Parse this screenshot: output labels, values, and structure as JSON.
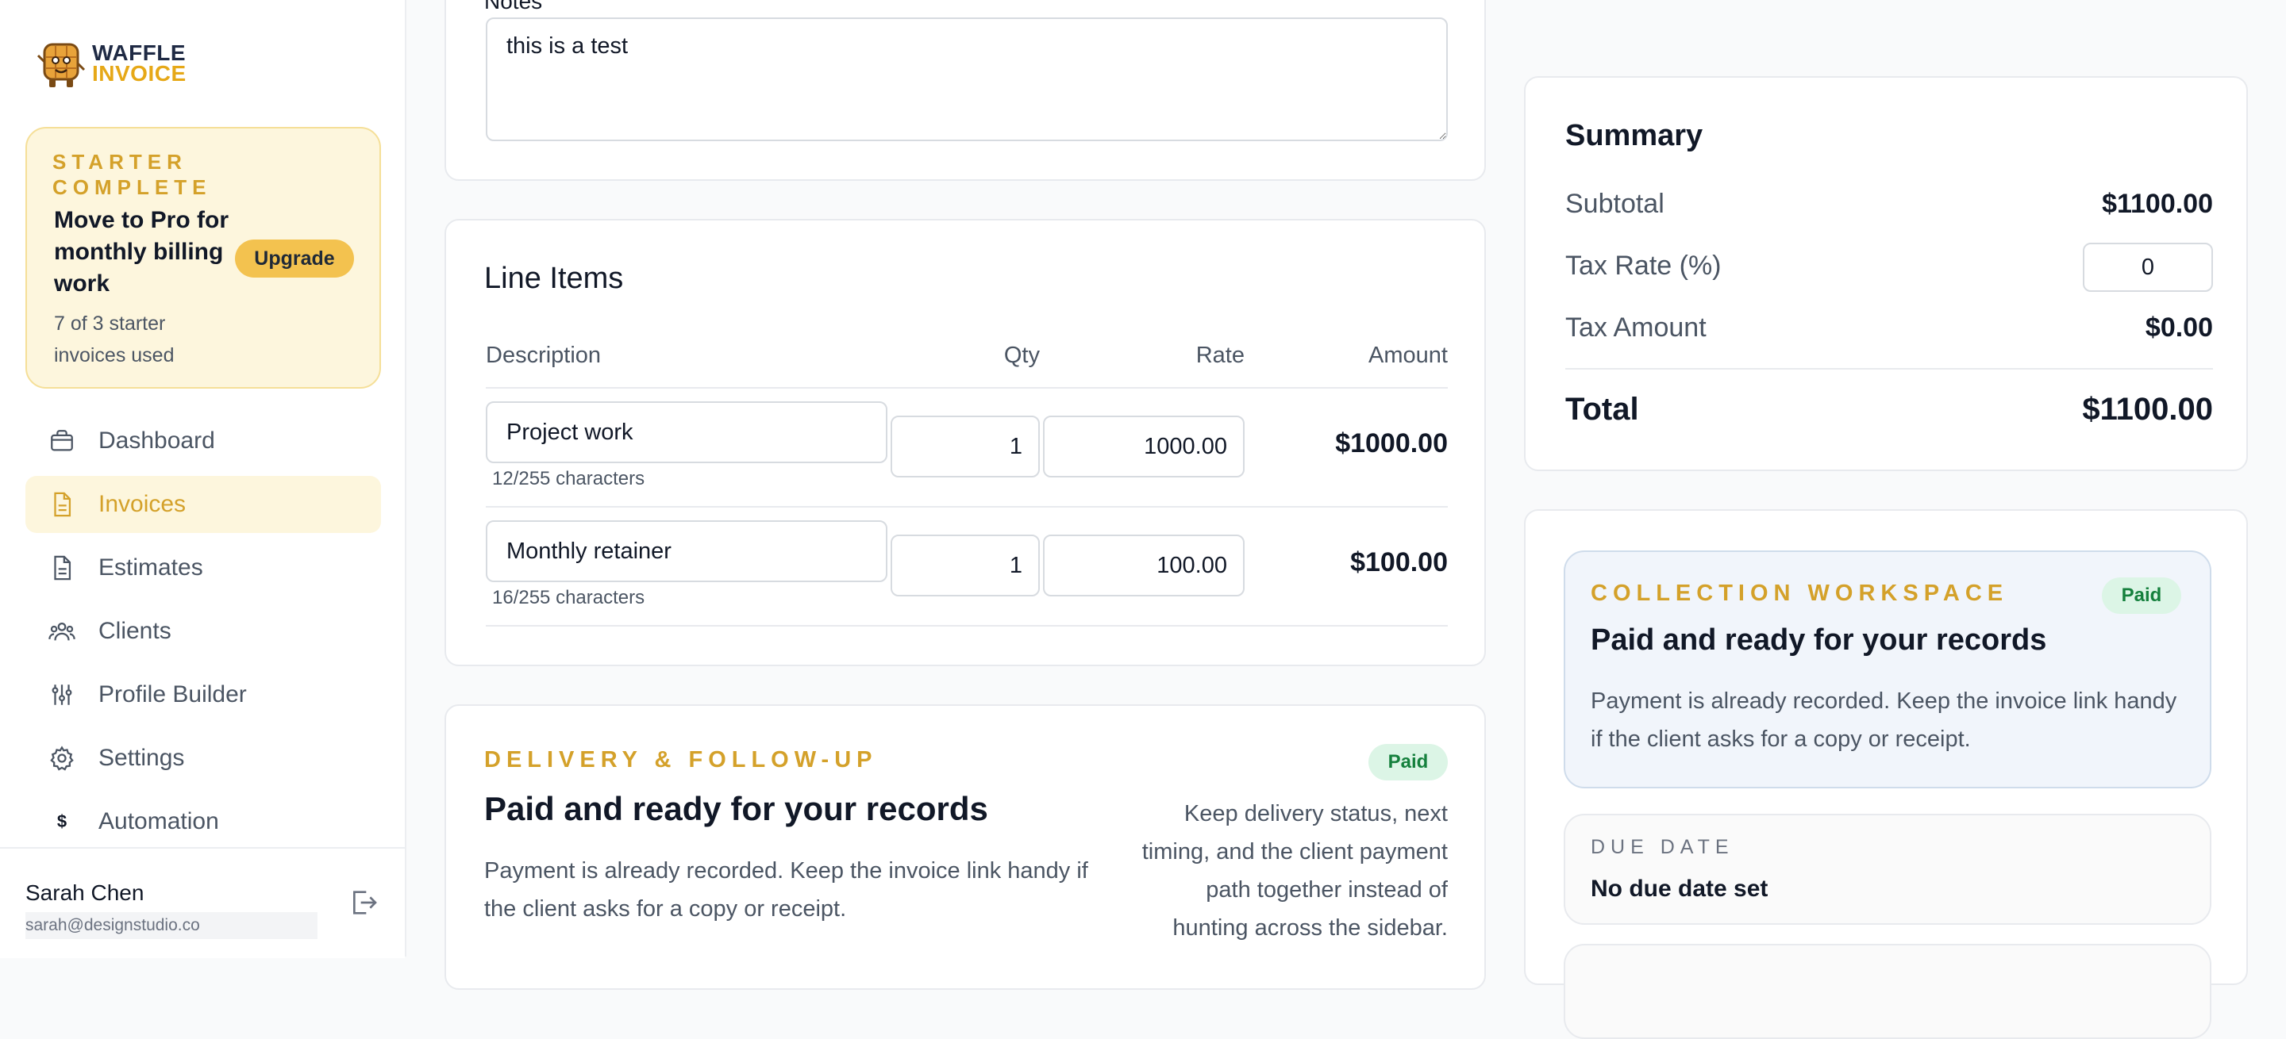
{
  "brand": {
    "logo_line1": "WAFFLE",
    "logo_line2": "INVOICE"
  },
  "promo": {
    "eyebrow": "STARTER COMPLETE",
    "title": "Move to Pro for monthly billing work",
    "usage": "7 of 3 starter invoices used",
    "upgrade_label": "Upgrade"
  },
  "nav": {
    "items": [
      {
        "label": "Dashboard",
        "icon": "briefcase-icon"
      },
      {
        "label": "Invoices",
        "icon": "document-icon",
        "active": true
      },
      {
        "label": "Estimates",
        "icon": "document-icon"
      },
      {
        "label": "Clients",
        "icon": "users-icon"
      },
      {
        "label": "Profile Builder",
        "icon": "sliders-icon"
      },
      {
        "label": "Settings",
        "icon": "gear-icon"
      },
      {
        "label": "Automation",
        "icon": "dollar-icon",
        "icon_glyph": "$"
      }
    ]
  },
  "user": {
    "name": "Sarah Chen",
    "email": "sarah@designstudio.co"
  },
  "notes": {
    "label": "Notes",
    "value": "this is a test"
  },
  "line_items": {
    "title": "Line Items",
    "columns": {
      "description": "Description",
      "qty": "Qty",
      "rate": "Rate",
      "amount": "Amount"
    },
    "rows": [
      {
        "description": "Project work",
        "chars": "12/255 characters",
        "qty": "1",
        "rate": "1000.00",
        "amount": "$1000.00"
      },
      {
        "description": "Monthly retainer",
        "chars": "16/255 characters",
        "qty": "1",
        "rate": "100.00",
        "amount": "$100.00"
      }
    ]
  },
  "delivery": {
    "eyebrow": "DELIVERY & FOLLOW-UP",
    "badge": "Paid",
    "title": "Paid and ready for your records",
    "body": "Payment is already recorded. Keep the invoice link handy if the client asks for a copy or receipt.",
    "aside": "Keep delivery status, next timing, and the client payment path together instead of hunting across the sidebar."
  },
  "summary": {
    "title": "Summary",
    "subtotal_label": "Subtotal",
    "subtotal_value": "$1100.00",
    "tax_rate_label": "Tax Rate (%)",
    "tax_rate_value": "0",
    "tax_amount_label": "Tax Amount",
    "tax_amount_value": "$0.00",
    "total_label": "Total",
    "total_value": "$1100.00"
  },
  "workspace": {
    "eyebrow": "COLLECTION WORKSPACE",
    "badge": "Paid",
    "title": "Paid and ready for your records",
    "body": "Payment is already recorded. Keep the invoice link handy if the client asks for a copy or receipt.",
    "due_label": "DUE DATE",
    "due_value": "No due date set"
  },
  "colors": {
    "accent": "#d4a12a",
    "accent_bg": "#fdf6dd",
    "paid_bg": "#dcf5e6",
    "paid_text": "#15803d"
  }
}
